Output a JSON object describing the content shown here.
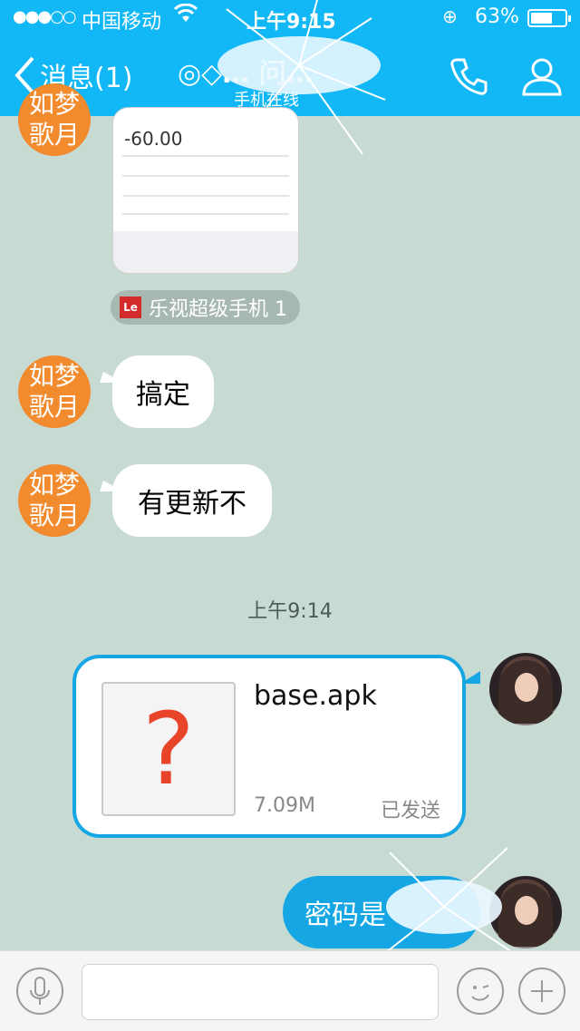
{
  "status_bar": {
    "signal": "●●●○○",
    "carrier": "中国移动",
    "time": "上午9:15",
    "battery": "63%",
    "battery_level": 0.63
  },
  "nav": {
    "back_label": "消息(1)",
    "title": "◎◇… 问…",
    "subtitle": "手机在线"
  },
  "messages": [
    {
      "side": "left",
      "type": "image",
      "image_amount": "-60.00",
      "source_tag": {
        "icon_text": "Le",
        "label": "乐视超级手机 1"
      },
      "avatar_text": [
        "如梦",
        "歌月"
      ]
    },
    {
      "side": "left",
      "type": "text",
      "text": "搞定",
      "avatar_text": [
        "如梦",
        "歌月"
      ]
    },
    {
      "side": "left",
      "type": "text",
      "text": "有更新不",
      "avatar_text": [
        "如梦",
        "歌月"
      ]
    }
  ],
  "timestamp": "上午9:14",
  "file_message": {
    "icon_glyph": "?",
    "name": "base.apk",
    "size": "7.09M",
    "status": "已发送"
  },
  "pwd_message": {
    "text": "密码是"
  },
  "input_bar": {
    "placeholder": ""
  },
  "colors": {
    "header": "#12b7f5",
    "chat_bg": "#c7dbd3",
    "avatar_bg": "#f28a2e",
    "outgoing": "#16a6e4"
  }
}
